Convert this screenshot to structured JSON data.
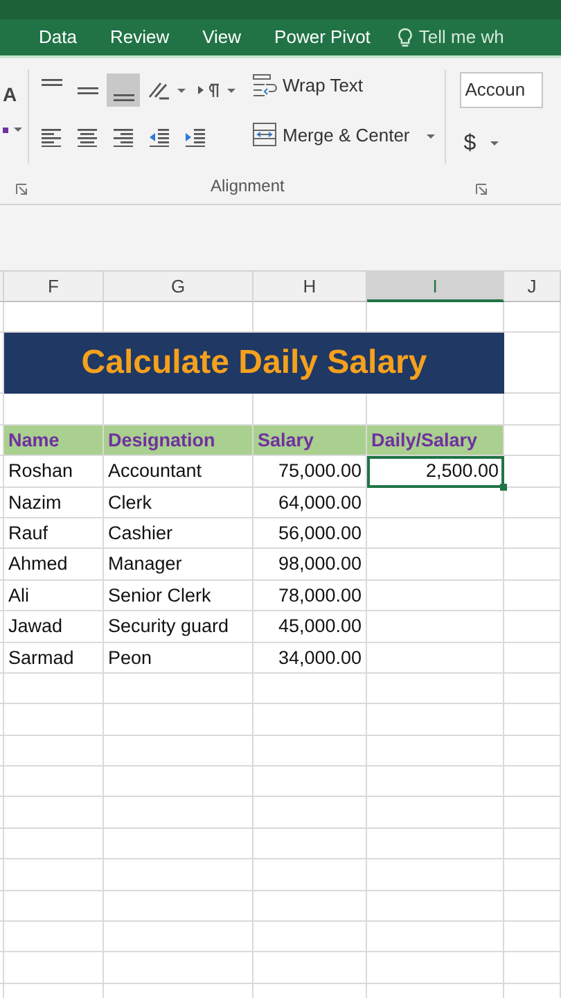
{
  "ribbon_tabs": [
    {
      "label": "Data",
      "selected": false
    },
    {
      "label": "Review",
      "selected": false
    },
    {
      "label": "View",
      "selected": false
    },
    {
      "label": "Power Pivot",
      "selected": false
    }
  ],
  "tell_me": {
    "placeholder": "Tell me wh"
  },
  "ribbon": {
    "font_grow": {
      "label": "A"
    },
    "align_top_row": [
      {
        "kind": "align-top",
        "selected": false
      },
      {
        "kind": "align-middle",
        "selected": false
      },
      {
        "kind": "align-bottom",
        "selected": true
      }
    ],
    "align_bottom_row": [
      {
        "kind": "align-left",
        "selected": false
      },
      {
        "kind": "align-center",
        "selected": false
      },
      {
        "kind": "align-right",
        "selected": false
      }
    ],
    "wrap_text": {
      "label": "Wrap Text"
    },
    "merge_center": {
      "label": "Merge & Center"
    },
    "group_label": "Alignment",
    "number_format": {
      "value": "Accoun"
    },
    "currency": {
      "label": "$"
    }
  },
  "sheet": {
    "columns": [
      {
        "label": "F",
        "selected": false
      },
      {
        "label": "G",
        "selected": false
      },
      {
        "label": "H",
        "selected": false
      },
      {
        "label": "I",
        "selected": true
      },
      {
        "label": "J",
        "selected": false
      }
    ],
    "title": "Calculate Daily Salary",
    "headers": [
      "Name",
      "Designation",
      "Salary",
      "Daily/Salary"
    ],
    "rows": [
      {
        "name": "Roshan",
        "designation": "Accountant",
        "salary": "75,000.00",
        "daily_salary": "2,500.00",
        "selected": true
      },
      {
        "name": "Nazim",
        "designation": "Clerk",
        "salary": "64,000.00",
        "selected": false
      },
      {
        "name": "Rauf",
        "designation": "Cashier",
        "salary": "56,000.00",
        "selected": false
      },
      {
        "name": "Ahmed",
        "designation": "Manager",
        "salary": "98,000.00",
        "selected": false
      },
      {
        "name": "Ali",
        "designation": "Senior Clerk",
        "salary": "78,000.00",
        "selected": false
      },
      {
        "name": "Jawad",
        "designation": "Security guard",
        "salary": "45,000.00",
        "selected": false
      },
      {
        "name": "Sarmad",
        "designation": "Peon",
        "salary": "34,000.00",
        "selected": false
      }
    ]
  }
}
